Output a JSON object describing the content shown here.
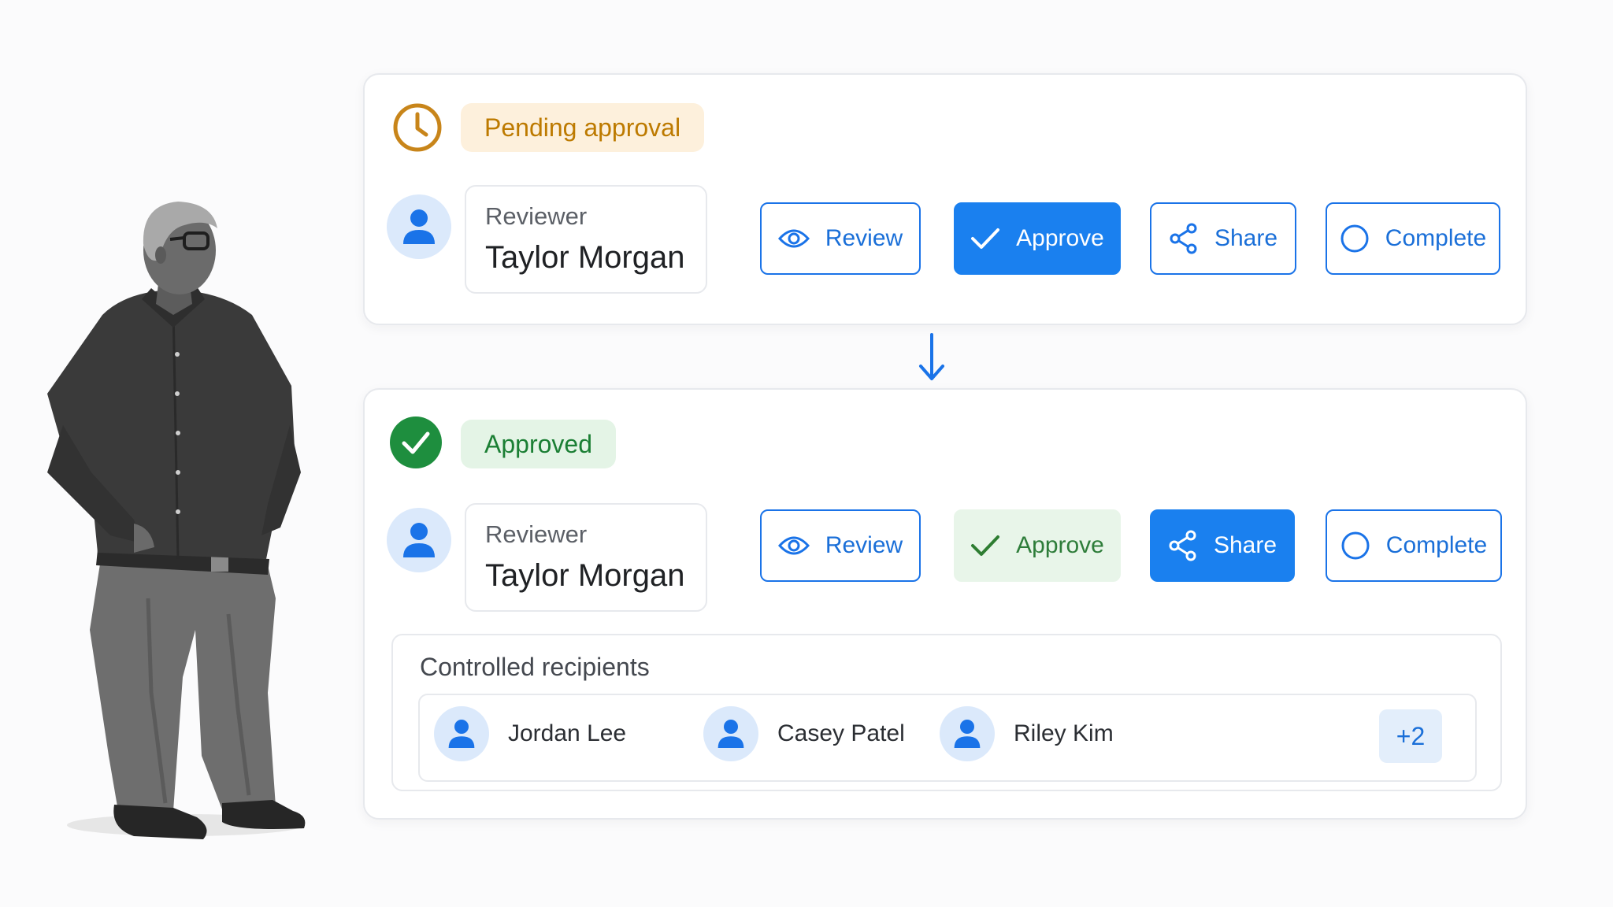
{
  "workflow": {
    "pending_card": {
      "status_label": "Pending approval",
      "status_icon": "clock-icon",
      "reviewer_role": "Reviewer",
      "reviewer_name": "Taylor Morgan",
      "actions": {
        "review": "Review",
        "approve": "Approve",
        "share": "Share",
        "complete": "Complete"
      },
      "active_action": "approve"
    },
    "approved_card": {
      "status_label": "Approved",
      "status_icon": "check-circle-icon",
      "reviewer_role": "Reviewer",
      "reviewer_name": "Taylor Morgan",
      "actions": {
        "review": "Review",
        "approve": "Approve",
        "share": "Share",
        "complete": "Complete"
      },
      "active_action": "share",
      "completed_action": "approve"
    },
    "recipients": {
      "title": "Controlled recipients",
      "people": [
        "Jordan Lee",
        "Casey Patel",
        "Riley Kim"
      ],
      "more_count": "+2"
    }
  },
  "colors": {
    "primary": "#1a80ef",
    "pending": "#bd7a00",
    "pending_bg": "#fdf0dc",
    "approved": "#1b7f34",
    "approved_bg": "#e4f4e6"
  }
}
